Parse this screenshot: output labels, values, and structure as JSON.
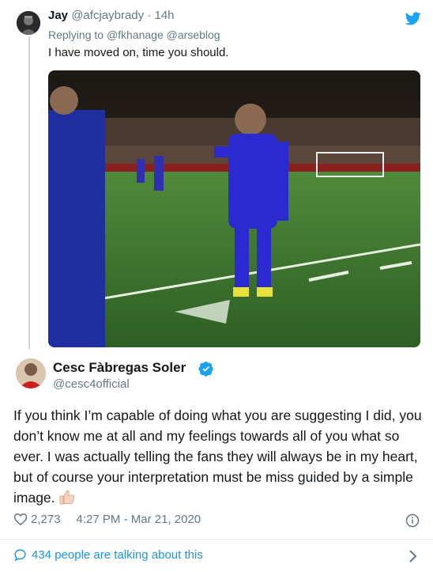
{
  "reply": {
    "name": "Jay",
    "handle": "@afcjaybrady",
    "separator": "·",
    "time": "14h",
    "replying_prefix": "Replying to",
    "replying_mentions": [
      "@fkhanage",
      "@arseblog"
    ],
    "text": "I have moved on, time you should."
  },
  "main_tweet": {
    "name": "Cesc Fàbregas Soler",
    "handle": "@cesc4official",
    "text": "If you think I’m capable of doing what you are suggesting I did, you don’t know me at all and my feelings towards all of you what so ever. I was actually telling the fans they will always be in my heart, but of course your interpretation must be miss guided by a simple image.",
    "emoji": "thumbs-up-light-skin",
    "likes": "2,273",
    "timestamp": "4:27 PM - Mar 21, 2020",
    "talking": "434 people are talking about this"
  },
  "icons": {
    "twitter": "twitter-bird-icon",
    "verified": "verified-badge-icon",
    "like": "heart-icon",
    "info": "info-icon",
    "comment": "comment-icon",
    "chevron": "chevron-right-icon"
  },
  "colors": {
    "accent": "#1da1f2",
    "link": "#1b95e0",
    "secondary_text": "#657786",
    "player_kit": "#2a2ad0",
    "pitch": "#3c7a2e"
  }
}
